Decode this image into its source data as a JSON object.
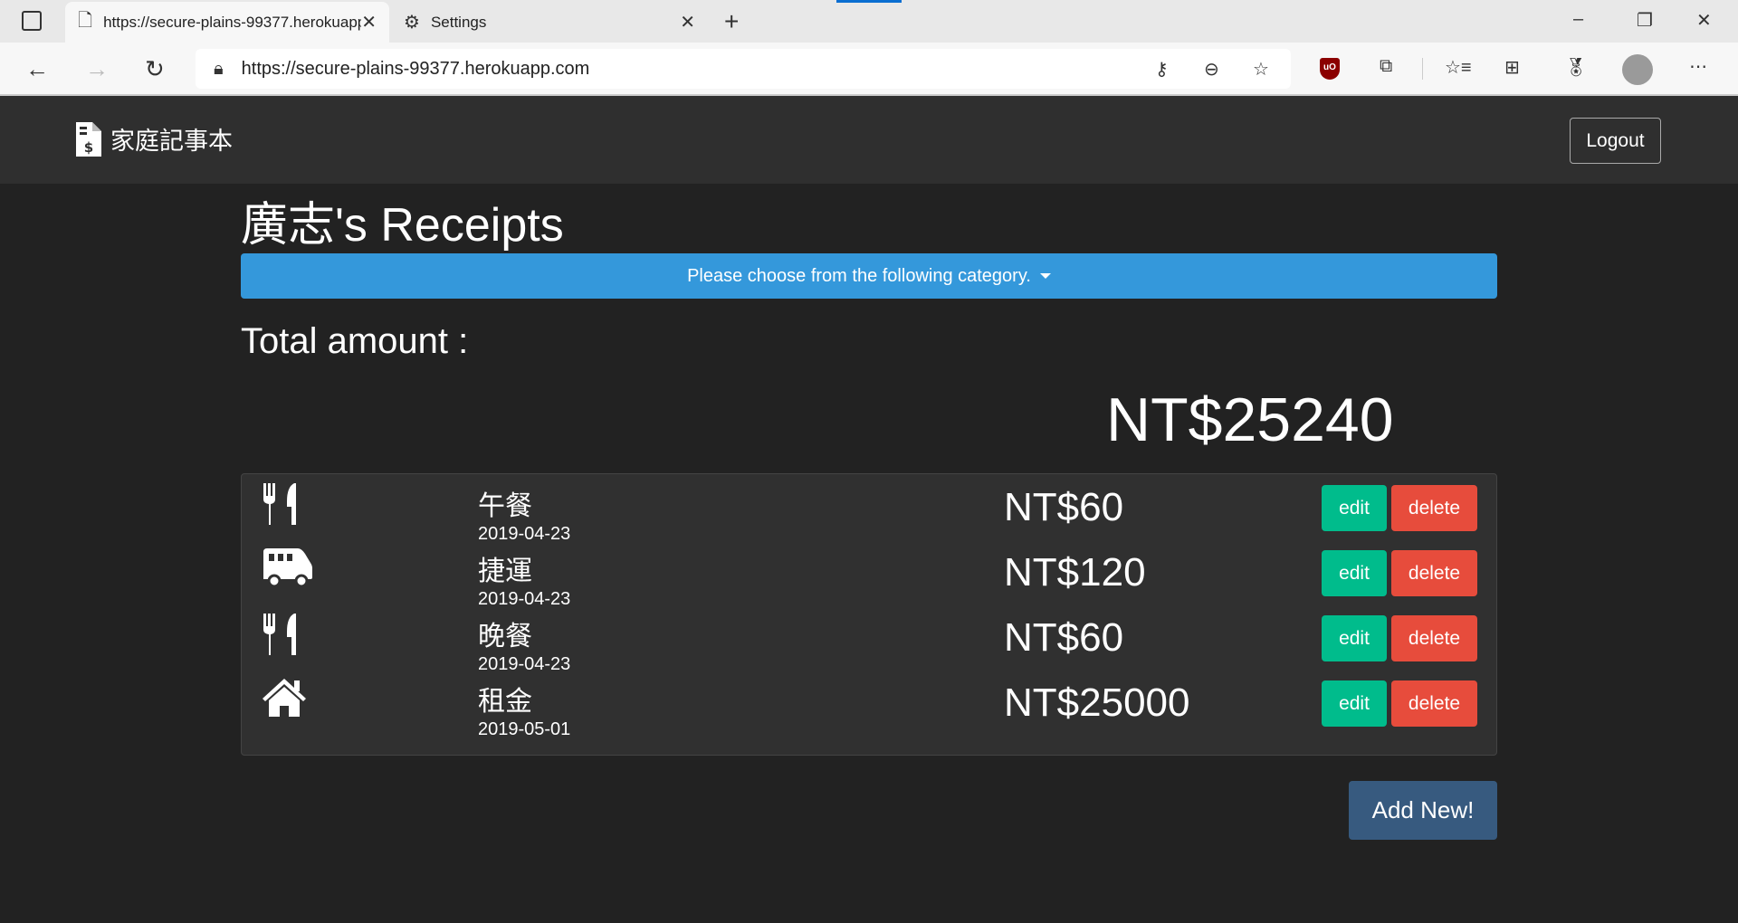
{
  "browser": {
    "tabs": [
      {
        "label": "https://secure-plains-99377.herokuapp.com"
      },
      {
        "label": "Settings"
      }
    ],
    "url": "https://secure-plains-99377.herokuapp.com",
    "extension_badge": "uO"
  },
  "navbar": {
    "brand": "家庭記事本",
    "logout": "Logout"
  },
  "page": {
    "title": "廣志's Receipts",
    "category_prompt": "Please choose from the following category.",
    "total_label": "Total amount :",
    "total_value": "NT$25240",
    "add_new": "Add New!"
  },
  "records": [
    {
      "icon": "utensils-icon",
      "name": "午餐",
      "date": "2019-04-23",
      "amount": "NT$60",
      "edit": "edit",
      "delete": "delete"
    },
    {
      "icon": "shuttle-van-icon",
      "name": "捷運",
      "date": "2019-04-23",
      "amount": "NT$120",
      "edit": "edit",
      "delete": "delete"
    },
    {
      "icon": "utensils-icon",
      "name": "晚餐",
      "date": "2019-04-23",
      "amount": "NT$60",
      "edit": "edit",
      "delete": "delete"
    },
    {
      "icon": "home-icon",
      "name": "租金",
      "date": "2019-05-01",
      "amount": "NT$25000",
      "edit": "edit",
      "delete": "delete"
    }
  ],
  "colors": {
    "primary": "#375a7f",
    "info": "#3498db",
    "success": "#00bc8c",
    "danger": "#e74c3c"
  }
}
